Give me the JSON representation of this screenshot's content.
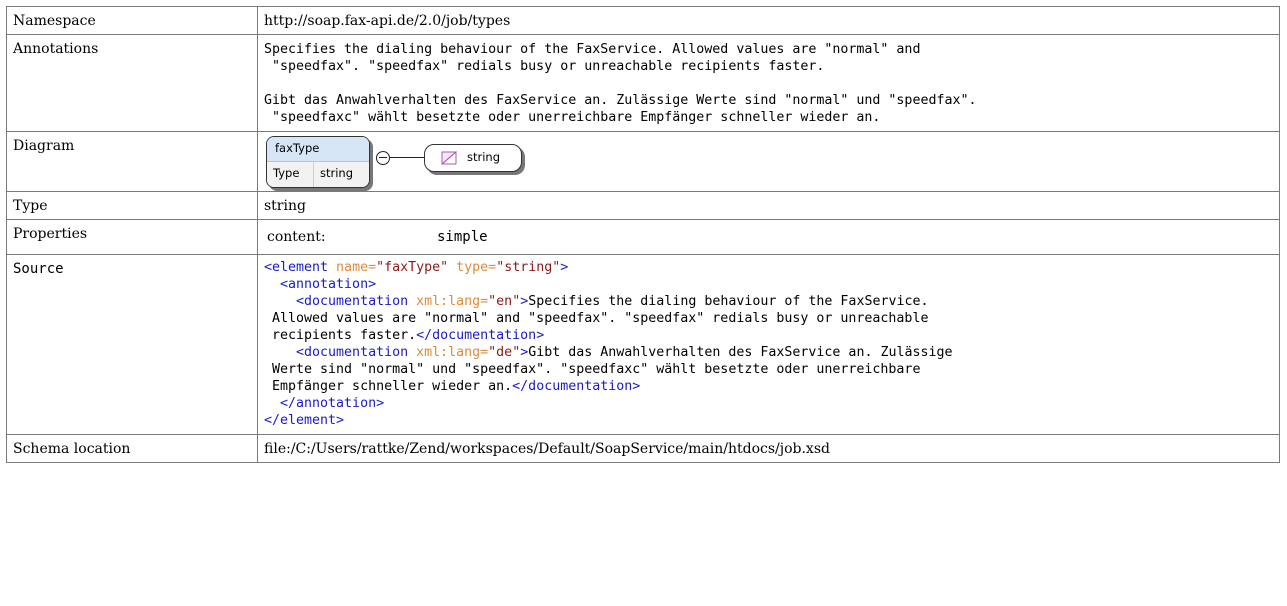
{
  "rows": {
    "namespace": {
      "label": "Namespace",
      "value": "http://soap.fax-api.de/2.0/job/types"
    },
    "annotations": {
      "label": "Annotations",
      "en": "Specifies the dialing behaviour of the FaxService. Allowed values are \"normal\" and\n \"speedfax\". \"speedfax\" redials busy or unreachable recipients faster.",
      "de": "Gibt das Anwahlverhalten des FaxService an. Zulässige Werte sind \"normal\" und \"speedfax\".\n \"speedfaxc\" wählt besetzte oder unerreichbare Empfänger schneller wieder an."
    },
    "diagram": {
      "label": "Diagram",
      "element_name": "faxType",
      "type_key": "Type",
      "type_value": "string",
      "base_type": "string",
      "base_type_icon": "simple-type-icon",
      "compositor_icon": "sequence-icon"
    },
    "type": {
      "label": "Type",
      "value": "string"
    },
    "properties": {
      "label": "Properties",
      "key": "content:",
      "value": "simple"
    },
    "source": {
      "label": "Source",
      "line1_open": "<element",
      "line1_attr1": " name=",
      "line1_val1": "\"faxType\"",
      "line1_attr2": " type=",
      "line1_val2": "\"string\"",
      "line1_close": ">",
      "line2": "  <annotation>",
      "doc_open": "    <documentation",
      "doc_attr": " xml:lang=",
      "doc_en_val": "\"en\"",
      "doc_gt": ">",
      "doc_en_text": "Specifies the dialing behaviour of the FaxService.\n Allowed values are \"normal\" and \"speedfax\". \"speedfax\" redials busy or unreachable\n recipients faster.",
      "doc_close": "</documentation>",
      "doc_de_val": "\"de\"",
      "doc_de_text": "Gibt das Anwahlverhalten des FaxService an. Zulässige\n Werte sind \"normal\" und \"speedfax\". \"speedfaxc\" wählt besetzte oder unerreichbare\n Empfänger schneller wieder an.",
      "annot_close": "  </annotation>",
      "elem_close": "</element>"
    },
    "schema_location": {
      "label": "Schema location",
      "value": "file:/C:/Users/rattke/Zend/workspaces/Default/SoapService/main/htdocs/job.xsd"
    }
  },
  "colors": {
    "tag": "#1a1acf",
    "attr": "#e08a3a",
    "value": "#8b1a1a",
    "border": "#7a7a7a",
    "diagram_header": "#d7e6f7"
  }
}
